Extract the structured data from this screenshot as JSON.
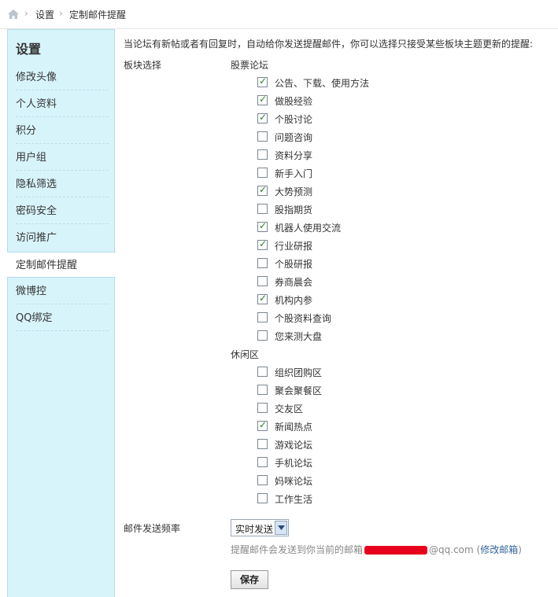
{
  "breadcrumb": {
    "item1": "设置",
    "item2": "定制邮件提醒"
  },
  "sidebar": {
    "title": "设置",
    "items": [
      {
        "label": "修改头像"
      },
      {
        "label": "个人资料"
      },
      {
        "label": "积分"
      },
      {
        "label": "用户组"
      },
      {
        "label": "隐私筛选"
      },
      {
        "label": "密码安全"
      },
      {
        "label": "访问推广"
      },
      {
        "label": "定制邮件提醒",
        "active": true
      },
      {
        "label": "微博控"
      },
      {
        "label": "QQ绑定"
      }
    ]
  },
  "intro": "当论坛有新帖或者有回复时，自动给你发送提醒邮件，你可以选择只接受某些板块主题更新的提醒:",
  "board_label": "板块选择",
  "groups": [
    {
      "title": "股票论坛",
      "items": [
        {
          "label": "公告、下载、使用方法",
          "checked": true
        },
        {
          "label": "做股经验",
          "checked": true
        },
        {
          "label": "个股讨论",
          "checked": true
        },
        {
          "label": "问题咨询",
          "checked": false
        },
        {
          "label": "资料分享",
          "checked": false
        },
        {
          "label": "新手入门",
          "checked": false
        },
        {
          "label": "大势预测",
          "checked": true
        },
        {
          "label": "股指期货",
          "checked": false
        },
        {
          "label": "机器人使用交流",
          "checked": true
        },
        {
          "label": "行业研报",
          "checked": true
        },
        {
          "label": "个股研报",
          "checked": false
        },
        {
          "label": "券商晨会",
          "checked": false
        },
        {
          "label": "机构内参",
          "checked": true
        },
        {
          "label": "个股资料查询",
          "checked": false
        },
        {
          "label": "您来测大盘",
          "checked": false
        }
      ]
    },
    {
      "title": "休闲区",
      "items": [
        {
          "label": "组织团购区",
          "checked": false
        },
        {
          "label": "聚会聚餐区",
          "checked": false
        },
        {
          "label": "交友区",
          "checked": false
        },
        {
          "label": "新闻热点",
          "checked": true
        },
        {
          "label": "游戏论坛",
          "checked": false
        },
        {
          "label": "手机论坛",
          "checked": false
        },
        {
          "label": "妈咪论坛",
          "checked": false
        },
        {
          "label": "工作生活",
          "checked": false
        }
      ]
    }
  ],
  "frequency": {
    "label": "邮件发送频率",
    "value": "实时发送"
  },
  "hint": {
    "prefix": "提醒邮件会发送到你当前的邮箱",
    "domain": "@qq.com",
    "open": "(",
    "link": "修改邮箱",
    "close": ")"
  },
  "save_label": "保存",
  "colors": {
    "sidebar_bg": "#d8f4fb",
    "check": "#237d2b",
    "link": "#336699"
  }
}
